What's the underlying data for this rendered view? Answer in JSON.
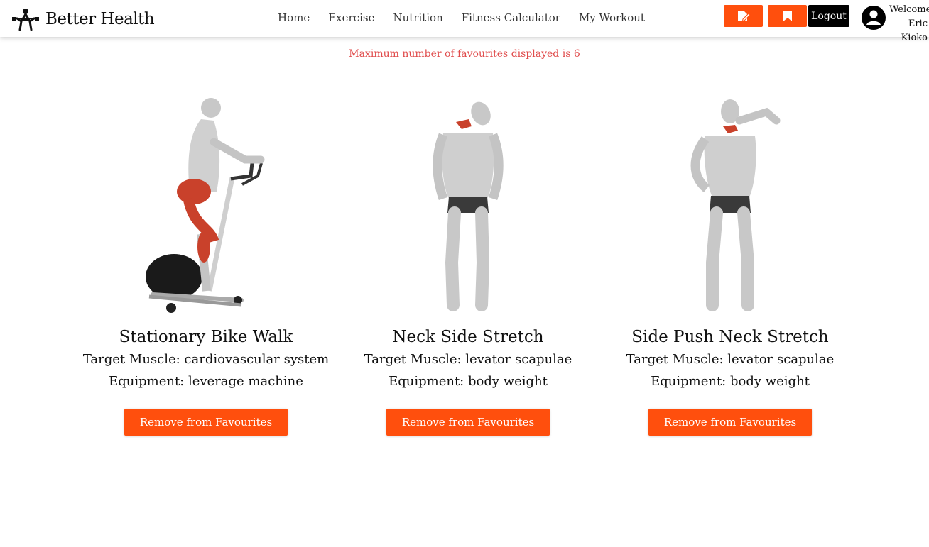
{
  "header": {
    "brand": "Better Health",
    "nav": [
      "Home",
      "Exercise",
      "Nutrition",
      "Fitness Calculator",
      "My Workout"
    ],
    "logout_label": "Logout",
    "welcome_line1": "Welcome",
    "welcome_line2": "Eric Kioko",
    "accent": "#ff4f0d"
  },
  "notice": "Maximum number of favourites displayed is 6",
  "favourites": [
    {
      "title": "Stationary Bike Walk",
      "target": "Target Muscle: cardiovascular system",
      "equipment": "Equipment: leverage machine",
      "button": "Remove from Favourites"
    },
    {
      "title": "Neck Side Stretch",
      "target": "Target Muscle: levator scapulae",
      "equipment": "Equipment: body weight",
      "button": "Remove from Favourites"
    },
    {
      "title": "Side Push Neck Stretch",
      "target": "Target Muscle: levator scapulae",
      "equipment": "Equipment: body weight",
      "button": "Remove from Favourites"
    }
  ]
}
